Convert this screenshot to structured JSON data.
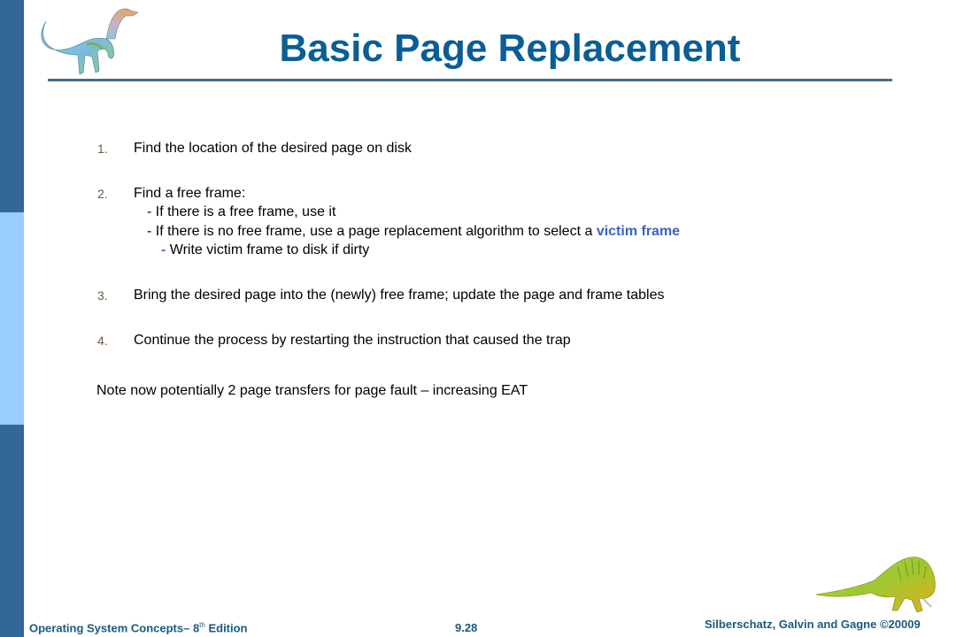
{
  "slide": {
    "title": "Basic Page Replacement",
    "steps": [
      {
        "number": "1.",
        "text": "Find the location of the desired page on disk"
      },
      {
        "number": "2.",
        "text": "Find a free frame:",
        "sub_items": [
          "-  If there is a free frame, use it",
          "-  If there is no free frame, use a page replacement algorithm to select a "
        ],
        "highlight": "victim frame",
        "sub_sub_bullet": "-",
        "sub_sub_text": " Write victim frame to disk if dirty"
      },
      {
        "number": "3.",
        "text": "Bring  the desired page into the (newly) free frame; update the page and frame tables"
      },
      {
        "number": "4.",
        "text": "Continue the process by restarting the instruction that caused the trap"
      }
    ],
    "note": "Note now potentially 2 page transfers for page fault – increasing EAT"
  },
  "footer": {
    "book_title": "Operating System Concepts– 8",
    "book_title_sup": "th",
    "book_title_suffix": " Edition",
    "page_number": "9.28",
    "copyright": "Silberschatz, Galvin and Gagne ©20009"
  },
  "icons": {
    "top_logo": "dinosaur-logo-icon",
    "bottom_logo": "dinosaur-crawling-icon"
  },
  "colors": {
    "title": "#0a5e94",
    "sidebar_dark": "#336699",
    "sidebar_light": "#99ccff",
    "highlight": "#3a63c8",
    "footer": "#1a5a80"
  }
}
